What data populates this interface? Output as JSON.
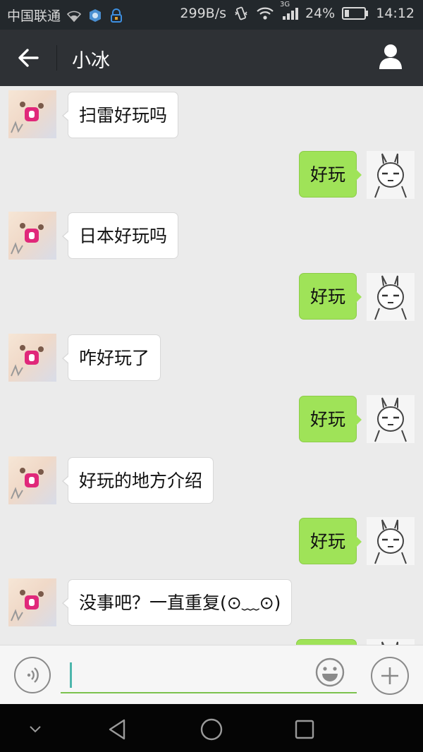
{
  "status_bar": {
    "carrier": "中国联通",
    "network_speed": "299B/s",
    "network_type": "3G",
    "battery_percent": "24%",
    "battery_level": 0.24,
    "time": "14:12"
  },
  "header": {
    "title": "小冰",
    "back_icon": "arrow-left-icon",
    "profile_icon": "person-icon"
  },
  "messages": [
    {
      "side": "left",
      "text": "扫雷好玩吗"
    },
    {
      "side": "right",
      "text": "好玩"
    },
    {
      "side": "left",
      "text": "日本好玩吗"
    },
    {
      "side": "right",
      "text": "好玩"
    },
    {
      "side": "left",
      "text": "咋好玩了"
    },
    {
      "side": "right",
      "text": "好玩"
    },
    {
      "side": "left",
      "text": "好玩的地方介绍"
    },
    {
      "side": "right",
      "text": "好玩"
    },
    {
      "side": "left",
      "text": "没事吧？一直重复(⊙﹏⊙)"
    },
    {
      "side": "right",
      "text": ""
    }
  ],
  "input_bar": {
    "placeholder": "",
    "value": "",
    "accent_color": "#7bc24e"
  },
  "colors": {
    "status_bar_bg": "#23282c",
    "title_bar_bg": "#2e3135",
    "chat_bg": "#ebebeb",
    "bubble_right": "#9fe358",
    "bubble_left": "#ffffff"
  }
}
